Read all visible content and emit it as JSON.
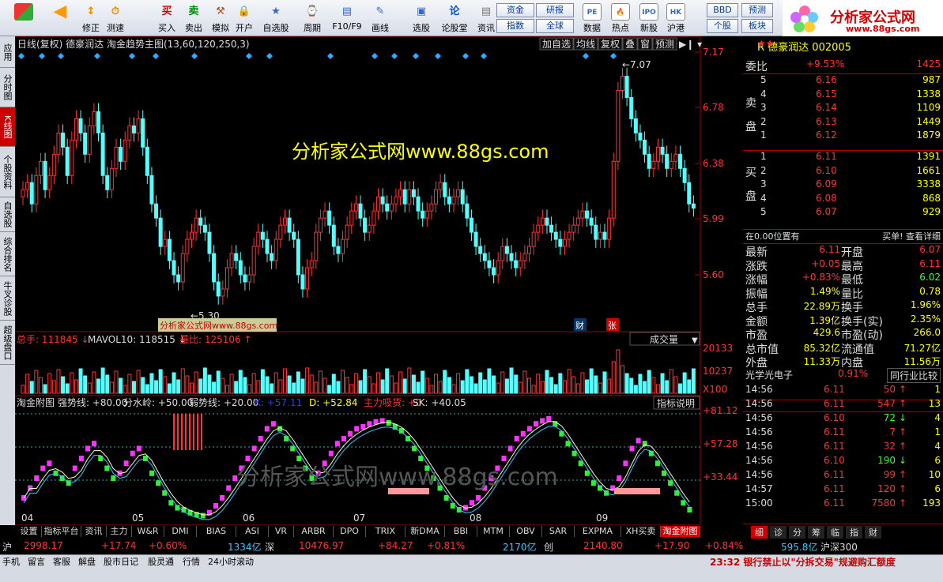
{
  "toolbar": {
    "buttons": [
      "修正",
      "测速",
      "买入",
      "卖出",
      "模拟",
      "开户",
      "自选股",
      "周期",
      "F10/F9",
      "画线",
      "选股",
      "论股堂",
      "资讯",
      "数据",
      "热点",
      "新股",
      "沪港通"
    ],
    "mid": [
      "资金",
      "研报",
      "指数",
      "全球",
      "BBD",
      "预测",
      "个股",
      "板块"
    ],
    "logo_text": "分析家公式网",
    "logo_url": "www.88gs.com"
  },
  "vtabs": [
    "应用",
    "分时图",
    "K线图",
    "个股资料",
    "自选股",
    "综合排名",
    "牛叉诊股",
    "超级盘口"
  ],
  "chart": {
    "title": "日线(复权)  德豪润达  淘金趋势主图(13,60,120,250,3)",
    "header_buttons": [
      "加自选",
      "均线",
      "复权",
      "叠",
      "窗",
      "预测"
    ],
    "price_ticks": [
      "7.17",
      "6.78",
      "6.38",
      "5.99",
      "5.60"
    ],
    "high_label": "7.07",
    "low_label": "5.30",
    "watermark": "分析家公式网www.88gs.com",
    "source_tag": "分析家公式网www.88gs.com",
    "cai": "财",
    "zhang": "张",
    "vol_label": "总手: 111845",
    "vol_ma": "MAVOL10: 118515",
    "vol_ratio": "量比: 125106",
    "vol_dropdown": "成交量",
    "vol_ticks": [
      "20133",
      "10237",
      "X100"
    ],
    "ind_label": "淘金附图",
    "ind_vals": [
      "强势线: +80.00",
      "分水岭: +50.00",
      "弱势线: +20.00",
      "K: +57.11",
      "D: +52.84",
      "主力吸货: +0",
      "SK: +40.05"
    ],
    "ind_button": "指标说明",
    "ind_ticks": [
      "+81.12",
      "+57.28",
      "+33.44"
    ],
    "watermark2": "分析家公式网www.88gs.com",
    "months": [
      "04",
      "05",
      "06",
      "07",
      "08",
      "09"
    ]
  },
  "right": {
    "title": "R 德豪润达 002005",
    "weibi_label": "委比",
    "weibi": "+9.53%",
    "weibi_v": "1425",
    "sell": [
      [
        "5",
        "6.16",
        "987"
      ],
      [
        "4",
        "6.15",
        "1338"
      ],
      [
        "3",
        "6.14",
        "1109"
      ],
      [
        "2",
        "6.13",
        "1449"
      ],
      [
        "1",
        "6.12",
        "1879"
      ]
    ],
    "buy": [
      [
        "1",
        "6.11",
        "1391"
      ],
      [
        "2",
        "6.10",
        "1661"
      ],
      [
        "3",
        "6.09",
        "3338"
      ],
      [
        "4",
        "6.08",
        "868"
      ],
      [
        "5",
        "6.07",
        "929"
      ]
    ],
    "sell_label": "卖盘",
    "buy_label": "买盘",
    "pos_text": "在0.00位置有",
    "pos_right": "买单! 查看详细",
    "stats": [
      [
        "最新",
        "6.11",
        "开盘",
        "6.07"
      ],
      [
        "涨跌",
        "+0.05",
        "最高",
        "6.11"
      ],
      [
        "涨幅",
        "+0.83%",
        "最低",
        "6.02"
      ],
      [
        "振幅",
        "1.49%",
        "量比",
        "0.78"
      ],
      [
        "总手",
        "22.89万",
        "换手",
        "1.96%"
      ],
      [
        "金额",
        "1.39亿",
        "换手(实)",
        "2.35%"
      ],
      [
        "市盈",
        "429.6",
        "市盈(动)",
        "266.0"
      ],
      [
        "总市值",
        "85.32亿",
        "流通值",
        "71.27亿"
      ],
      [
        "外盘",
        "11.33万",
        "内盘",
        "11.56万"
      ]
    ],
    "industry": "光学光电子",
    "industry_pct": "0.91%",
    "compare": "同行业比较",
    "ticks": [
      [
        "14:56",
        "6.11",
        "50",
        "1"
      ],
      [
        "14:56",
        "6.11",
        "547",
        "13"
      ],
      [
        "14:56",
        "6.10",
        "72",
        "4"
      ],
      [
        "14:56",
        "6.11",
        "7",
        "1"
      ],
      [
        "14:56",
        "6.11",
        "32",
        "4"
      ],
      [
        "14:56",
        "6.10",
        "190",
        "6"
      ],
      [
        "14:56",
        "6.11",
        "99",
        "10"
      ],
      [
        "14:57",
        "6.11",
        "120",
        "6"
      ],
      [
        "15:00",
        "6.11",
        "7580",
        "193"
      ]
    ],
    "bottom_tabs": [
      "细",
      "诊",
      "分",
      "筹",
      "临",
      "指",
      "财"
    ]
  },
  "btabs": [
    "设置",
    "指标平台",
    "资讯",
    "主力",
    "W&R",
    "DMI",
    "BIAS",
    "ASI",
    "VR",
    "ARBR",
    "DPO",
    "TRIX",
    "新DMA",
    "BBI",
    "MTM",
    "OBV",
    "SAR",
    "EXPMA",
    "XH买卖",
    "淘金附图"
  ],
  "idx": {
    "sh": "沪",
    "sh_v": "2998.17",
    "sh_c": "+17.74",
    "sh_p": "+0.60%",
    "sh_a": "1334亿",
    "sz": "深",
    "sz_v": "10476.97",
    "sz_c": "+84.27",
    "sz_p": "+0.81%",
    "sz_a": "2170亿",
    "cy": "创",
    "cy_v": "2140.80",
    "cy_c": "+17.90",
    "cy_p": "+0.84%",
    "hs_a": "595.8亿",
    "hs": "沪深300"
  },
  "status": {
    "items": [
      "手机",
      "留言",
      "客服",
      "解盘",
      "股市日记",
      "股灵通",
      "行情",
      "24小时滚动"
    ],
    "news": "23:32 银行禁止以\"分拆交易\"规避购汇额度"
  },
  "colors": {
    "up": "#ff3333",
    "down": "#54ffff",
    "pink": "#ff33ff",
    "green": "#33ee33"
  }
}
